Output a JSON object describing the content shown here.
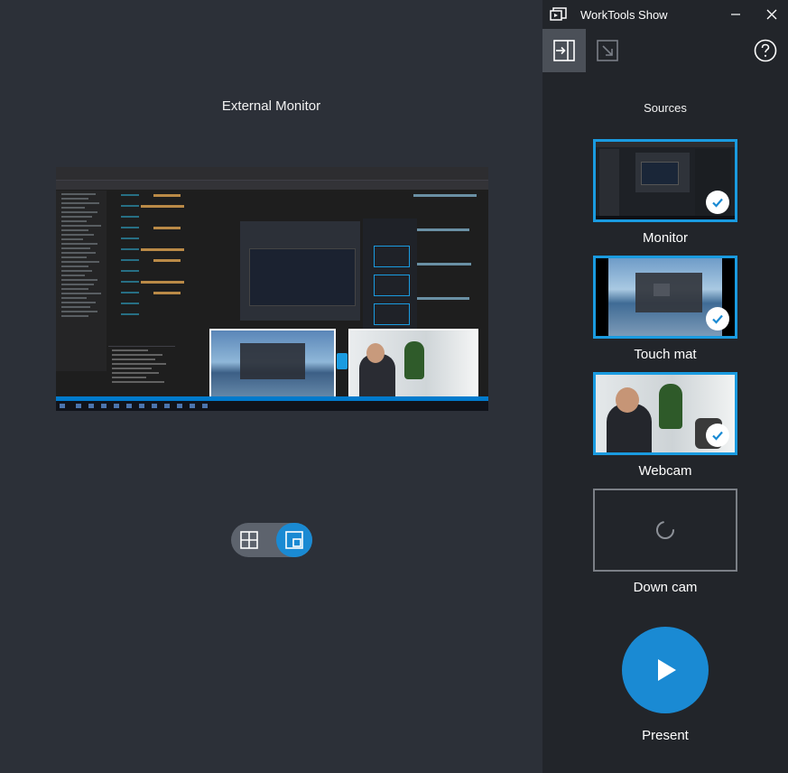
{
  "stage": {
    "title": "External Monitor"
  },
  "window": {
    "title": "WorkTools Show"
  },
  "sidebar": {
    "sources_title": "Sources",
    "sources": [
      {
        "label": "Monitor",
        "selected": true
      },
      {
        "label": "Touch mat",
        "selected": true
      },
      {
        "label": "Webcam",
        "selected": true
      },
      {
        "label": "Down cam",
        "selected": false,
        "loading": true
      }
    ],
    "present_label": "Present"
  },
  "icons": {
    "app": "present-screen-icon",
    "minimize": "minimize-icon",
    "close": "close-icon",
    "dock": "dock-panel-icon",
    "undock": "undock-arrow-icon",
    "help": "help-circle-icon",
    "layout_grid": "grid-layout-icon",
    "layout_pip": "picture-in-picture-icon",
    "check": "checkmark-icon",
    "spinner": "loading-spinner-icon",
    "play": "play-icon"
  },
  "colors": {
    "accent": "#1a8ad3",
    "selection_border": "#1a9be0",
    "stage_bg": "#2c3038",
    "sidebar_bg": "#22252a"
  }
}
